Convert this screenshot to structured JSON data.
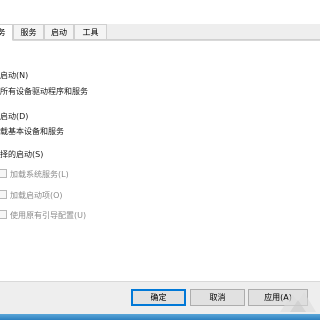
{
  "tabs": [
    {
      "label": "务",
      "active": true
    },
    {
      "label": "服务",
      "active": false
    },
    {
      "label": "启动",
      "active": false
    },
    {
      "label": "工具",
      "active": false
    }
  ],
  "options": {
    "normal_title": "启动(N)",
    "normal_desc": "所有设备驱动程序和服务",
    "diagnostic_title": "启动(D)",
    "diagnostic_desc": "载基本设备和服务",
    "selective_title": "择的启动(S)",
    "load_system_services": "加载系统服务(L)",
    "load_startup_items": "加载启动项(O)",
    "use_original_boot": "使用原有引导配置(U)"
  },
  "buttons": {
    "ok": "确定",
    "cancel": "取消",
    "apply": "应用(A)"
  }
}
